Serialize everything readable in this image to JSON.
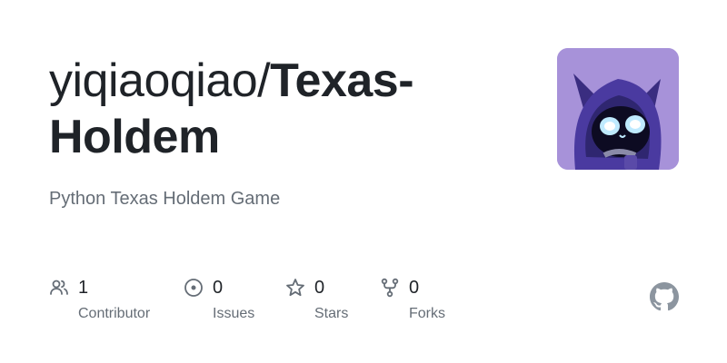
{
  "repo": {
    "owner": "yiqiaoqiao/",
    "name": "Texas-Holdem",
    "description": "Python Texas Holdem Game"
  },
  "stats": {
    "contributors": {
      "icon": "people-icon",
      "value": "1",
      "label": "Contributor"
    },
    "issues": {
      "icon": "issue-icon",
      "value": "0",
      "label": "Issues"
    },
    "stars": {
      "icon": "star-icon",
      "value": "0",
      "label": "Stars"
    },
    "forks": {
      "icon": "fork-icon",
      "value": "0",
      "label": "Forks"
    }
  },
  "colors": {
    "title": "#1f2328",
    "muted": "#656d76",
    "avatar_bg": "#a792d9"
  },
  "brand_icon": "github-icon"
}
